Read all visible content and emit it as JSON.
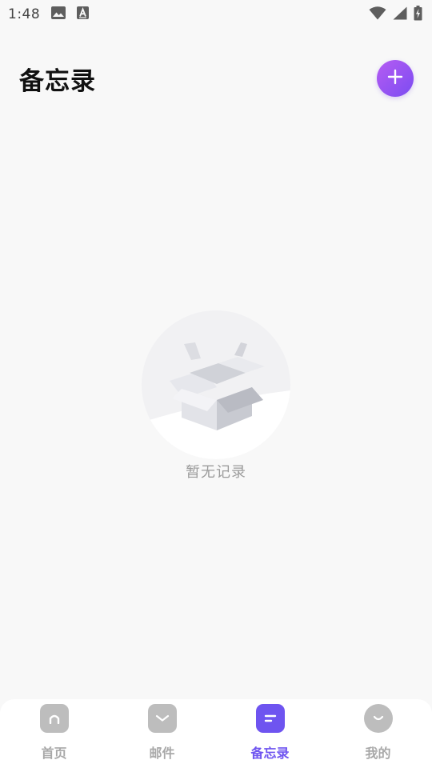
{
  "status_bar": {
    "time": "1:48",
    "left_icons": [
      "image-icon",
      "font-a-icon"
    ],
    "right_icons": [
      "wifi-icon",
      "cellular-signal-icon",
      "battery-charging-icon"
    ]
  },
  "header": {
    "title": "备忘录",
    "add_icon": "plus-icon"
  },
  "empty_state": {
    "illustration": "empty-box-illustration",
    "text": "暂无记录"
  },
  "bottom_nav": {
    "items": [
      {
        "label": "首页",
        "icon": "home-icon",
        "active": false
      },
      {
        "label": "邮件",
        "icon": "mail-icon",
        "active": false
      },
      {
        "label": "备忘录",
        "icon": "memo-icon",
        "active": true
      },
      {
        "label": "我的",
        "icon": "profile-icon",
        "active": false
      }
    ]
  },
  "colors": {
    "accent": "#6e54f0",
    "fab_gradient_start": "#b65cf3",
    "fab_gradient_end": "#7b4cf1",
    "inactive_icon": "#bdbdbd",
    "inactive_label": "#a8a8a8",
    "background": "#f8f8f8"
  }
}
